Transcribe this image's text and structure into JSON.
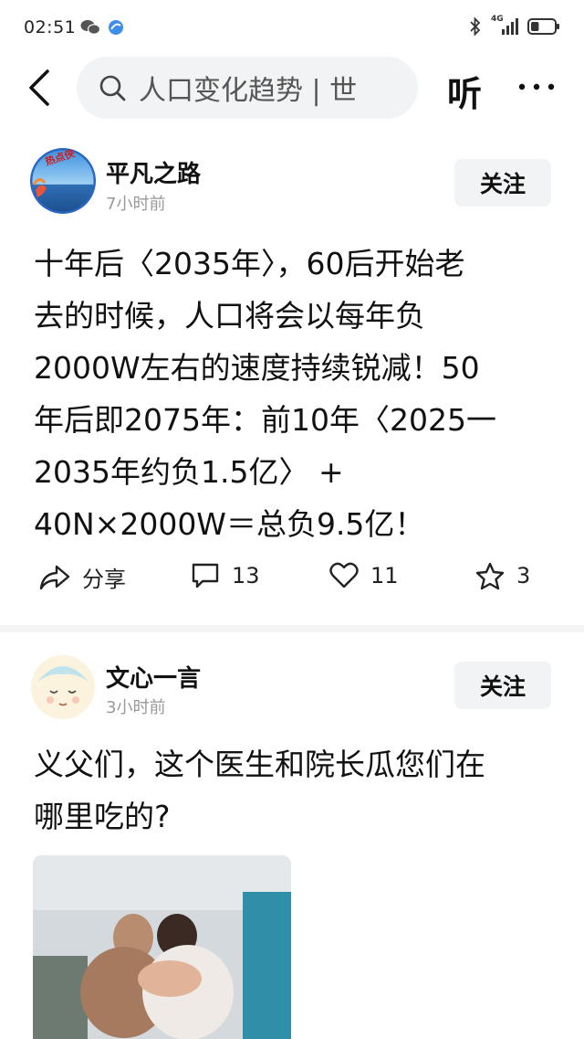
{
  "status_bar": {
    "time": "02:51",
    "network": "4G",
    "battery_level": 0.35
  },
  "header": {
    "search_text": "人口变化趋势 | 世",
    "listen_label": "听"
  },
  "posts": [
    {
      "author": "平凡之路",
      "time": "7小时前",
      "avatar_badge": "热点侠",
      "follow_label": "关注",
      "lines": [
        "十年后〈2035年〉，60后开始老",
        "去的时候，人口将会以每年负",
        "2000W左右的速度持续锐减！50",
        "年后即2075年：前10年〈2025一",
        "2035年约负1.5亿〉 +",
        "40N×2000W＝总负9.5亿！"
      ],
      "actions": {
        "share_label": "分享",
        "comments": "13",
        "likes": "11",
        "favorites": "3"
      }
    },
    {
      "author": "文心一言",
      "time": "3小时前",
      "follow_label": "关注",
      "lines": [
        "义父们，这个医生和院长瓜您们在",
        "哪里吃的?"
      ]
    }
  ],
  "colors": {
    "background": "#ffffff",
    "search_bg": "#f2f3f5",
    "button_bg": "#f2f3f5",
    "muted_text": "#999999",
    "divider": "#f3f4f6"
  }
}
